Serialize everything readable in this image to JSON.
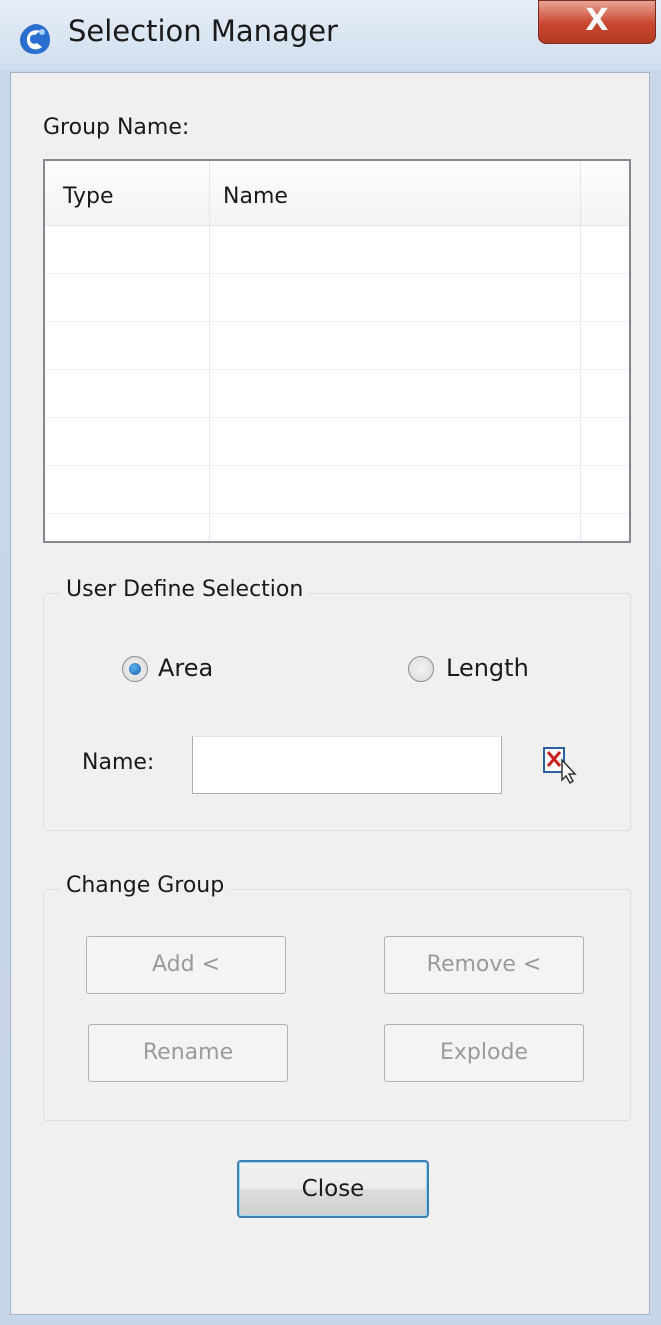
{
  "window": {
    "title": "Selection Manager",
    "close_glyph": "X"
  },
  "group": {
    "label": "Group Name:",
    "columns": [
      "Type",
      "Name"
    ],
    "rows": []
  },
  "user_define": {
    "title": "User Define Selection",
    "options": [
      {
        "label": "Area",
        "selected": true
      },
      {
        "label": "Length",
        "selected": false
      }
    ],
    "name_label": "Name:",
    "name_value": "",
    "pick_icon": "select-object-icon"
  },
  "change_group": {
    "title": "Change Group",
    "buttons": {
      "add": "Add <",
      "remove": "Remove <",
      "rename": "Rename",
      "explode": "Explode"
    }
  },
  "footer": {
    "close": "Close"
  },
  "colors": {
    "accent": "#3c7fb1",
    "close_red": "#c9462f",
    "disabled_text": "#9a9a9a"
  }
}
